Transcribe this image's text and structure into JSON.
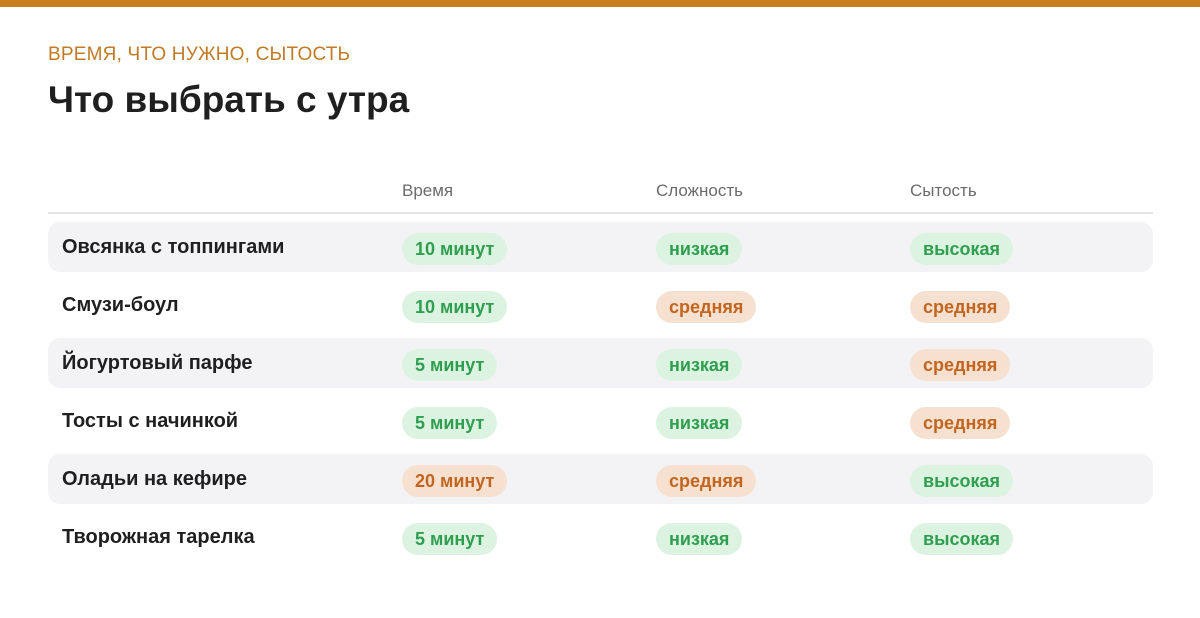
{
  "header": {
    "eyebrow": "ВРЕМЯ, ЧТО НУЖНО, СЫТОСТЬ",
    "title": "Что выбрать с утра"
  },
  "colors": {
    "accent": "#c8801f",
    "good_bg": "#dcf3e2",
    "good_text": "#2f9e4f",
    "mid_bg": "#f6e1d1",
    "mid_text": "#c2651f"
  },
  "table": {
    "columns": [
      "",
      "Время",
      "Сложность",
      "Сытость"
    ],
    "rows": [
      {
        "name": "Овсянка с топпингами",
        "time": {
          "text": "10 минут",
          "level": "good"
        },
        "difficulty": {
          "text": "низкая",
          "level": "good"
        },
        "satiety": {
          "text": "высокая",
          "level": "good"
        }
      },
      {
        "name": "Смузи-боул",
        "time": {
          "text": "10 минут",
          "level": "good"
        },
        "difficulty": {
          "text": "средняя",
          "level": "mid"
        },
        "satiety": {
          "text": "средняя",
          "level": "mid"
        }
      },
      {
        "name": "Йогуртовый парфе",
        "time": {
          "text": "5 минут",
          "level": "good"
        },
        "difficulty": {
          "text": "низкая",
          "level": "good"
        },
        "satiety": {
          "text": "средняя",
          "level": "mid"
        }
      },
      {
        "name": "Тосты с начинкой",
        "time": {
          "text": "5 минут",
          "level": "good"
        },
        "difficulty": {
          "text": "низкая",
          "level": "good"
        },
        "satiety": {
          "text": "средняя",
          "level": "mid"
        }
      },
      {
        "name": "Оладьи на кефире",
        "time": {
          "text": "20 минут",
          "level": "mid"
        },
        "difficulty": {
          "text": "средняя",
          "level": "mid"
        },
        "satiety": {
          "text": "высокая",
          "level": "good"
        }
      },
      {
        "name": "Творожная тарелка",
        "time": {
          "text": "5 минут",
          "level": "good"
        },
        "difficulty": {
          "text": "низкая",
          "level": "good"
        },
        "satiety": {
          "text": "высокая",
          "level": "good"
        }
      }
    ]
  }
}
